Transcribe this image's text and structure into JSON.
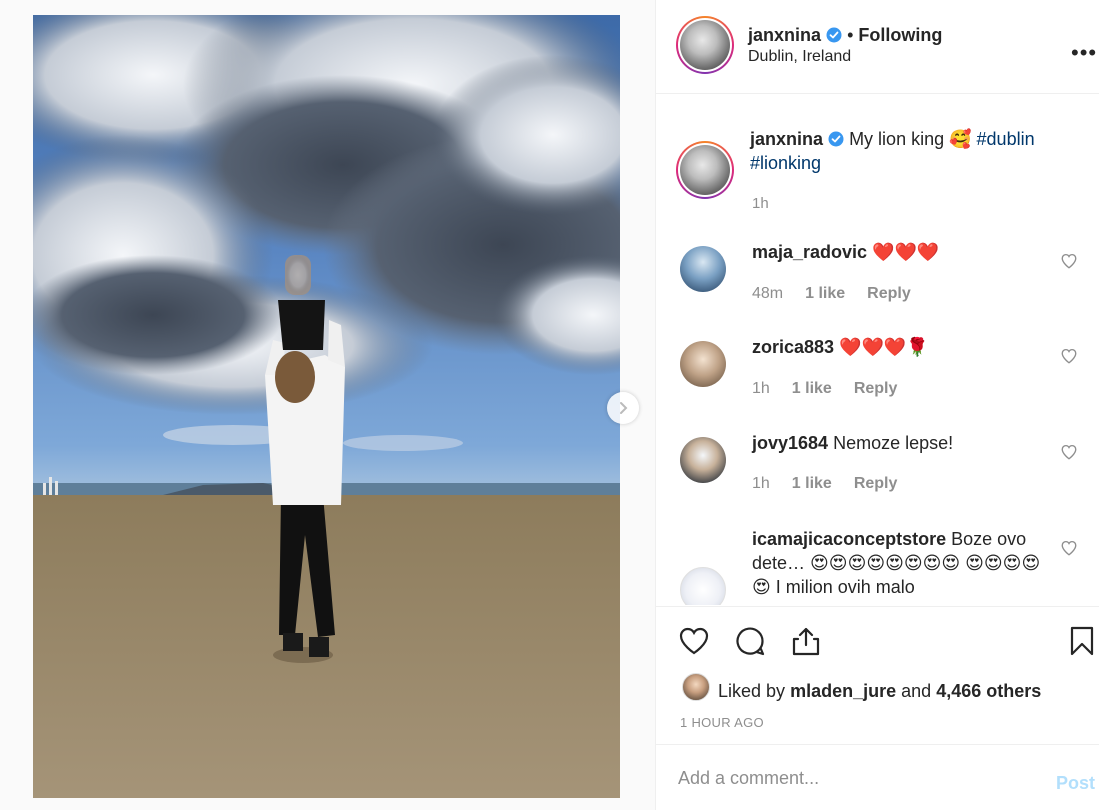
{
  "post": {
    "username": "janxnina",
    "separator": "•",
    "follow_status": "Following",
    "location": "Dublin, Ireland",
    "more_icon": "more-options-icon"
  },
  "caption": {
    "username": "janxnina",
    "text": "My lion king 🥰",
    "hashtags": [
      "#dublin",
      "#lionking"
    ],
    "time": "1h"
  },
  "comments": [
    {
      "username": "maja_radovic",
      "text": "❤️❤️❤️",
      "time": "48m",
      "likes": "1 like",
      "reply": "Reply"
    },
    {
      "username": "zorica883",
      "text": "❤️❤️❤️🌹",
      "time": "1h",
      "likes": "1 like",
      "reply": "Reply"
    },
    {
      "username": "jovy1684",
      "text": "Nemoze lepse!",
      "time": "1h",
      "likes": "1 like",
      "reply": "Reply"
    },
    {
      "username": "icamajicaconceptstore",
      "text": "Boze ovo dete… 😍😍😍😍😍😍😍😍 😍😍😍😍😍 I milion ovih malo"
    }
  ],
  "likes": {
    "prefix": "Liked by",
    "user": "mladen_jure",
    "joiner": "and",
    "others": "4,466 others"
  },
  "timestamp": "1 HOUR AGO",
  "add_comment": {
    "placeholder": "Add a comment...",
    "post_label": "Post"
  },
  "carousel": {
    "slide_count": 4,
    "active_index": 0
  },
  "colors": {
    "link": "#00376b",
    "verified": "#3897f0",
    "muted": "#8e8e8e",
    "post_disabled": "#b2dffc"
  }
}
